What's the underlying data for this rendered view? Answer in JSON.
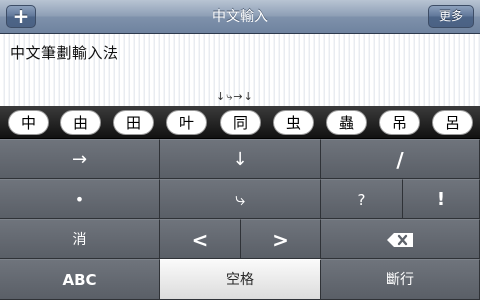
{
  "navbar": {
    "title": "中文輸入",
    "add_label": "+",
    "more_label": "更多"
  },
  "editor": {
    "text": "中文筆劃輸入法",
    "stroke_sequence": "↓⤷→↓"
  },
  "candidates": [
    "中",
    "由",
    "田",
    "叶",
    "同",
    "虫",
    "蟲",
    "吊",
    "呂"
  ],
  "keyboard": {
    "row1": [
      "→",
      "↓",
      "/"
    ],
    "row2": [
      "•",
      "⤷",
      "?",
      "!"
    ],
    "row3": {
      "clear": "消",
      "left": "<",
      "right": ">",
      "delete_icon": "backspace-icon"
    },
    "row4": {
      "abc": "ABC",
      "space": "空格",
      "return": "斷行"
    }
  }
}
